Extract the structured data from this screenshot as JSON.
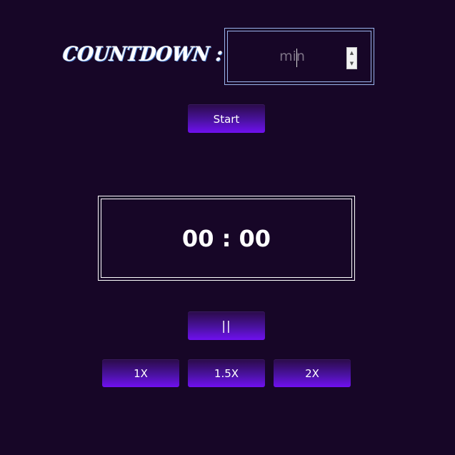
{
  "header": {
    "countdown_label": "COUNTDOWN :"
  },
  "minutes_input": {
    "value": "",
    "placeholder": "min",
    "spinner_up_icon": "▲",
    "spinner_down_icon": "▼"
  },
  "controls": {
    "start_label": "Start",
    "pause_label": "||"
  },
  "timer": {
    "display": "00 : 00"
  },
  "speed": {
    "options": [
      "1X",
      "1.5X",
      "2X"
    ]
  },
  "colors": {
    "background": "#170627",
    "button_gradient_top": "#2a0b48",
    "button_gradient_bottom": "#7010f0",
    "input_border": "#9ab4ec",
    "timer_border": "#ffffff"
  }
}
